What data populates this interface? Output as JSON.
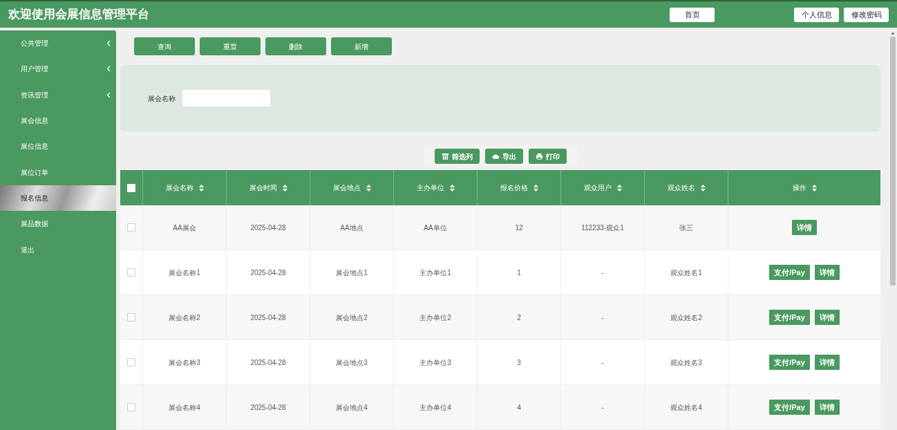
{
  "header": {
    "title": "欢迎使用会展信息管理平台",
    "buttons": [
      "首页",
      "个人信息",
      "修改密码"
    ]
  },
  "sidebar": {
    "items": [
      {
        "label": "公共管理",
        "expandable": true,
        "selected": false
      },
      {
        "label": "用户管理",
        "expandable": true,
        "selected": false
      },
      {
        "label": "资讯管理",
        "expandable": true,
        "selected": false
      },
      {
        "label": "展会信息",
        "expandable": false,
        "selected": false
      },
      {
        "label": "展位信息",
        "expandable": false,
        "selected": false
      },
      {
        "label": "展位订单",
        "expandable": false,
        "selected": false
      },
      {
        "label": "报名信息",
        "expandable": false,
        "selected": true
      },
      {
        "label": "展品数据",
        "expandable": false,
        "selected": false
      },
      {
        "label": "退出",
        "expandable": false,
        "selected": false
      }
    ]
  },
  "toolbar": {
    "buttons": [
      "查询",
      "重置",
      "删除",
      "新增"
    ]
  },
  "search": {
    "label": "展会名称"
  },
  "table_tools": [
    {
      "kind": "filter",
      "label": "筛选列"
    },
    {
      "kind": "export",
      "label": "导出"
    },
    {
      "kind": "print",
      "label": "打印"
    }
  ],
  "table": {
    "all_checked": false,
    "columns": [
      "展会名称",
      "展会时间",
      "展会地点",
      "主办单位",
      "报名价格",
      "观众用户",
      "观众姓名",
      "操作"
    ],
    "rows": [
      {
        "checked": false,
        "cells": [
          "AA展会",
          "2025-04-28",
          "AA地点",
          "AA单位",
          "12",
          "112233-观众1",
          "张三"
        ],
        "actions": [
          "详情"
        ]
      },
      {
        "checked": false,
        "cells": [
          "展会名称1",
          "2025-04-28",
          "展会地点1",
          "主办单位1",
          "1",
          "-",
          "观众姓名1"
        ],
        "actions": [
          "支付/Pay",
          "详情"
        ]
      },
      {
        "checked": false,
        "cells": [
          "展会名称2",
          "2025-04-28",
          "展会地点2",
          "主办单位2",
          "2",
          "-",
          "观众姓名2"
        ],
        "actions": [
          "支付/Pay",
          "详情"
        ]
      },
      {
        "checked": false,
        "cells": [
          "展会名称3",
          "2025-04-28",
          "展会地点3",
          "主办单位3",
          "3",
          "-",
          "观众姓名3"
        ],
        "actions": [
          "支付/Pay",
          "详情"
        ]
      },
      {
        "checked": false,
        "cells": [
          "展会名称4",
          "2025-04-28",
          "展会地点4",
          "主办单位4",
          "4",
          "-",
          "观众姓名4"
        ],
        "actions": [
          "支付/Pay",
          "详情"
        ]
      }
    ]
  }
}
